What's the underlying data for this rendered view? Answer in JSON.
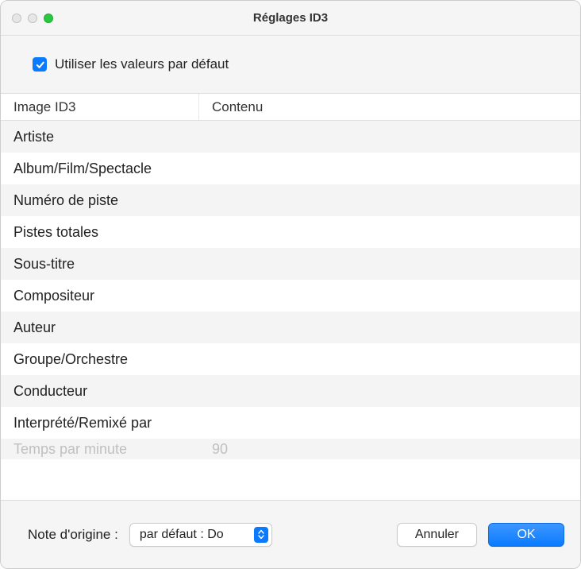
{
  "window": {
    "title": "Réglages ID3"
  },
  "checkbox": {
    "checked": true,
    "label": "Utiliser les valeurs par défaut"
  },
  "tableHeaders": {
    "image": "Image ID3",
    "content": "Contenu"
  },
  "rows": [
    {
      "label": "Artiste",
      "content": ""
    },
    {
      "label": "Album/Film/Spectacle",
      "content": ""
    },
    {
      "label": "Numéro de piste",
      "content": ""
    },
    {
      "label": "Pistes totales",
      "content": ""
    },
    {
      "label": "Sous-titre",
      "content": ""
    },
    {
      "label": "Compositeur",
      "content": ""
    },
    {
      "label": "Auteur",
      "content": ""
    },
    {
      "label": "Groupe/Orchestre",
      "content": ""
    },
    {
      "label": "Conducteur",
      "content": ""
    },
    {
      "label": "Interprété/Remixé par",
      "content": ""
    }
  ],
  "cutoffRow": {
    "label": "Temps par minute",
    "content": "90"
  },
  "bottomBar": {
    "noteLabel": "Note d'origine :",
    "popupValue": "par défaut : Do",
    "cancelLabel": "Annuler",
    "okLabel": "OK"
  }
}
